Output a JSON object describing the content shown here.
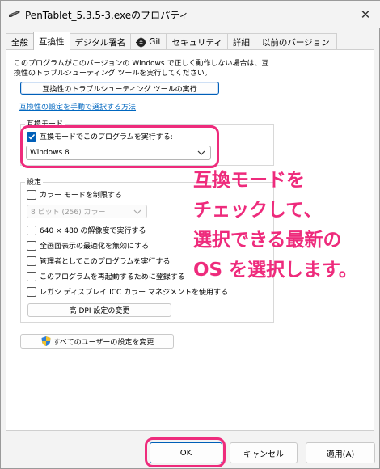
{
  "window": {
    "title": "PenTablet_5.3.5-3.exeのプロパティ",
    "close_glyph": "✕"
  },
  "tabs": [
    {
      "label": "全般"
    },
    {
      "label": "互換性",
      "active": true
    },
    {
      "label": "デジタル署名"
    },
    {
      "label": "Git"
    },
    {
      "label": "セキュリティ"
    },
    {
      "label": "詳細"
    },
    {
      "label": "以前のバージョン"
    }
  ],
  "intro_text": "このプログラムがこのバージョンの Windows で正しく動作しない場合は、互\n換性のトラブルシューティング ツールを実行してください。",
  "troubleshoot_button": "互換性のトラブルシューティング ツールの実行",
  "manual_link": "互換性の設定を手動で選択する方法",
  "compat_mode": {
    "group_label": "互換モード",
    "checkbox_label": "互換モードでこのプログラムを実行する:",
    "checked": true,
    "selected_os": "Windows 8"
  },
  "settings": {
    "group_label": "設定",
    "reduced_color_label": "カラー モードを制限する",
    "color_select": "8 ビット (256) カラー",
    "options": [
      "640 × 480 の解像度で実行する",
      "全画面表示の最適化を無効にする",
      "管理者としてこのプログラムを実行する",
      "このプログラムを再起動するために登録する",
      "レガシ ディスプレイ ICC カラー マネジメントを使用する"
    ],
    "dpi_button": "高 DPI 設定の変更"
  },
  "all_users_button": "すべてのユーザーの設定を変更",
  "footer": {
    "ok": "OK",
    "cancel": "キャンセル",
    "apply": "適用(A)"
  },
  "annotation": "互換モードを\nチェックして、\n選択できる最新の\nOS を選択します。",
  "colors": {
    "highlight": "#ee2b7c",
    "accent": "#005fb8",
    "link": "#0067c0"
  }
}
